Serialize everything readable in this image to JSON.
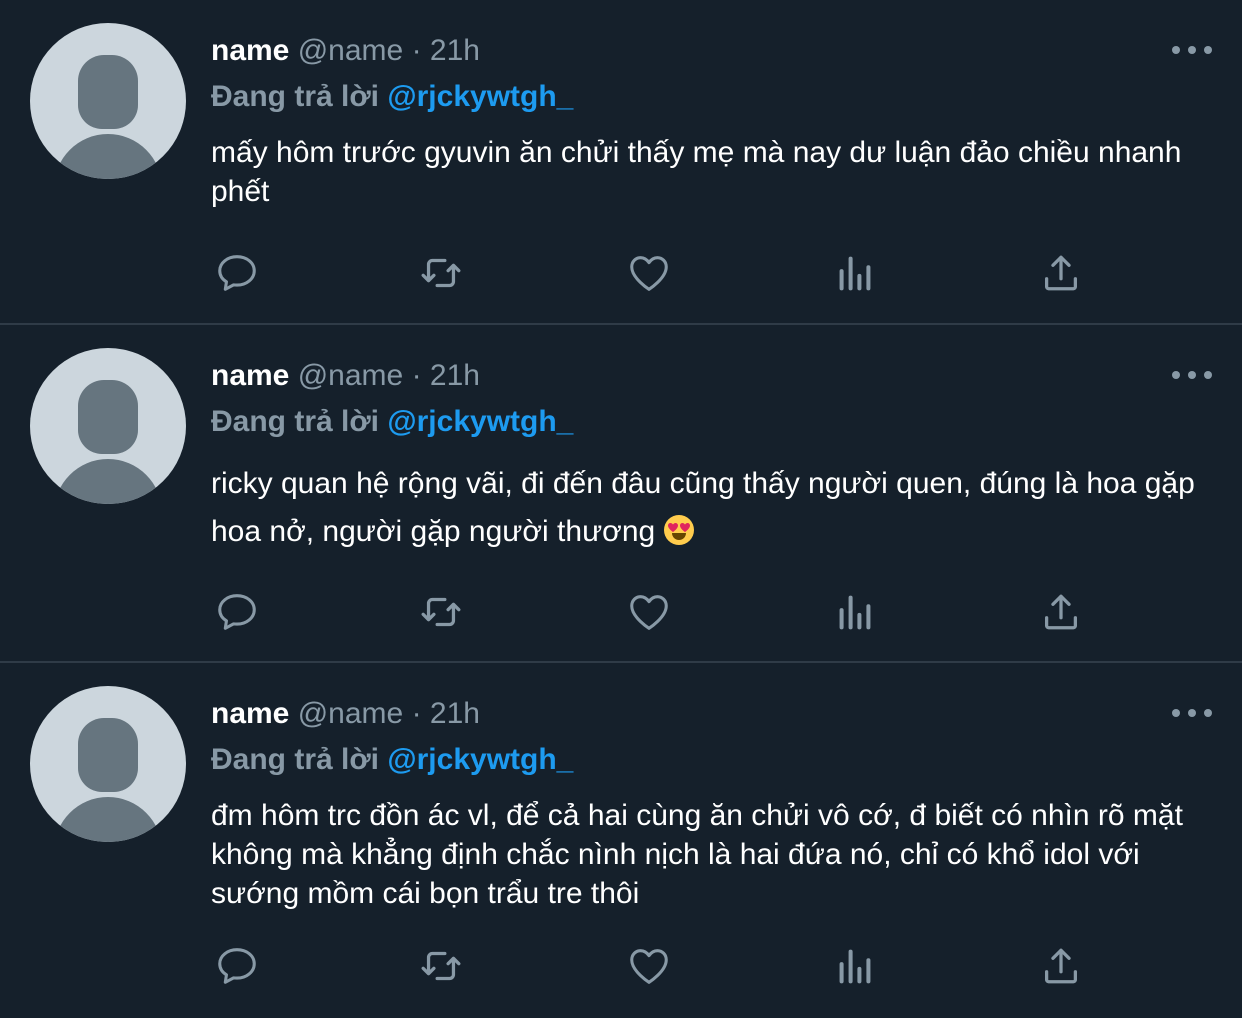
{
  "tweets": [
    {
      "name": "name",
      "handle": "@name",
      "separator": "·",
      "time": "21h",
      "reply_label": "Đang trả lời",
      "reply_to": "@rjckywtgh_",
      "text": "mấy hôm trước gyuvin ăn chửi thấy mẹ mà nay dư luận đảo chiều nhanh phết",
      "emoji": ""
    },
    {
      "name": "name",
      "handle": "@name",
      "separator": "·",
      "time": "21h",
      "reply_label": "Đang trả lời",
      "reply_to": "@rjckywtgh_",
      "text": "ricky quan hệ rộng vãi, đi đến đâu cũng thấy người quen, đúng là hoa gặp hoa nở, người gặp người thương",
      "emoji": "smiling-face-with-heart-eyes"
    },
    {
      "name": "name",
      "handle": "@name",
      "separator": "·",
      "time": "21h",
      "reply_label": "Đang trả lời",
      "reply_to": "@rjckywtgh_",
      "text": "đm hôm trc đồn ác vl, để cả hai cùng ăn chửi vô cớ, đ biết có nhìn rõ mặt không mà khẳng định chắc nình nịch là hai đứa nó, chỉ có khổ idol với sướng mồm cái bọn trẩu tre thôi",
      "emoji": ""
    }
  ],
  "icons": [
    "reply-icon",
    "retweet-icon",
    "like-icon",
    "analytics-icon",
    "share-icon",
    "more-icon",
    "default-avatar-icon"
  ],
  "colors": {
    "background": "#15202b",
    "secondary_text": "#8899a6",
    "mention": "#1d9bf0",
    "divider": "#2f3b47",
    "avatar_bg": "#ccd6dd",
    "avatar_fg": "#66757f"
  }
}
